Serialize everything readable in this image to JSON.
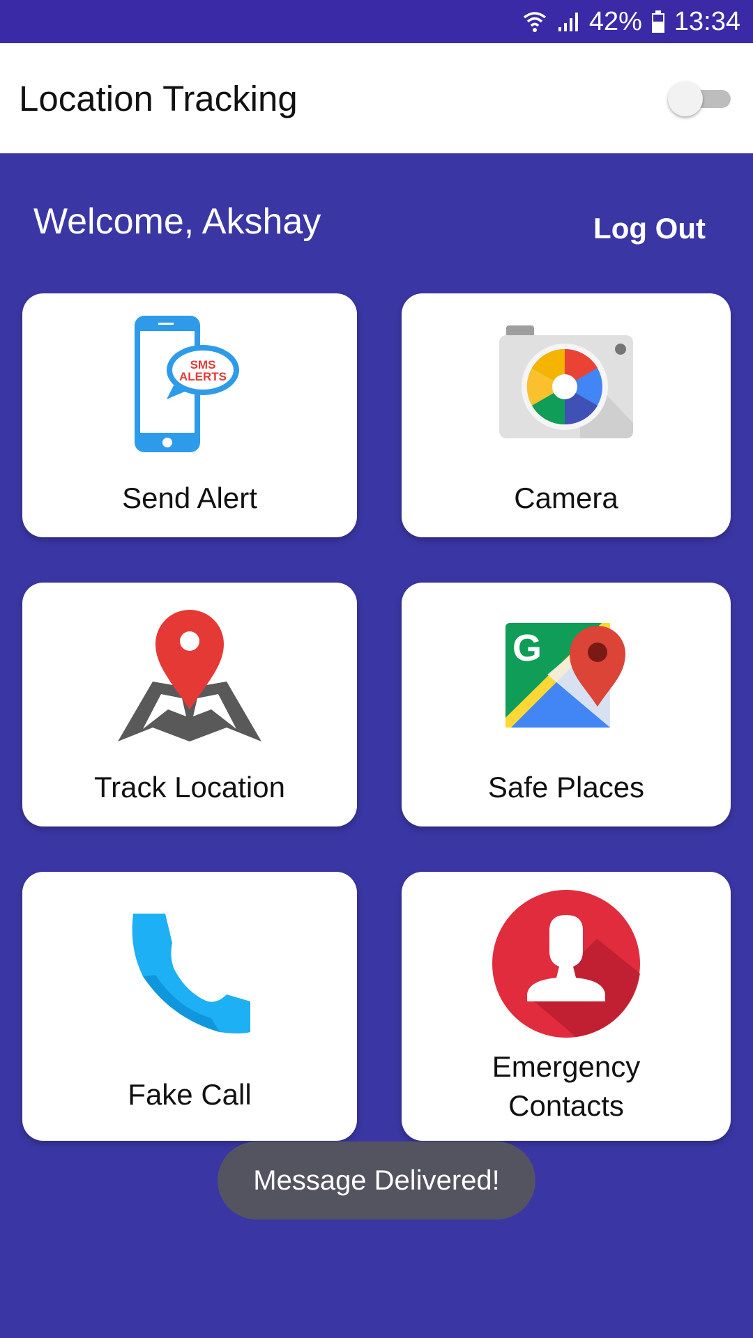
{
  "status_bar": {
    "battery": "42%",
    "time": "13:34",
    "icons": [
      "wifi-icon",
      "signal-icon",
      "battery-icon"
    ]
  },
  "app_bar": {
    "title": "Location Tracking",
    "tracking_toggle_on": false
  },
  "header": {
    "welcome": "Welcome, Akshay",
    "logout": "Log Out"
  },
  "tiles": [
    {
      "label": "Send Alert",
      "icon": "sms-alert-phone-icon",
      "icon_text": "SMS ALERTS"
    },
    {
      "label": "Camera",
      "icon": "camera-icon"
    },
    {
      "label": "Track Location",
      "icon": "map-pin-icon"
    },
    {
      "label": "Safe Places",
      "icon": "google-maps-icon"
    },
    {
      "label": "Fake Call",
      "icon": "phone-icon"
    },
    {
      "label_line1": "Emergency",
      "label_line2": "Contacts",
      "icon": "contact-icon"
    }
  ],
  "toast": "Message Delivered!",
  "colors": {
    "background": "#3A37A5",
    "status_bar": "#3A2AA6",
    "toast": "#545461"
  }
}
